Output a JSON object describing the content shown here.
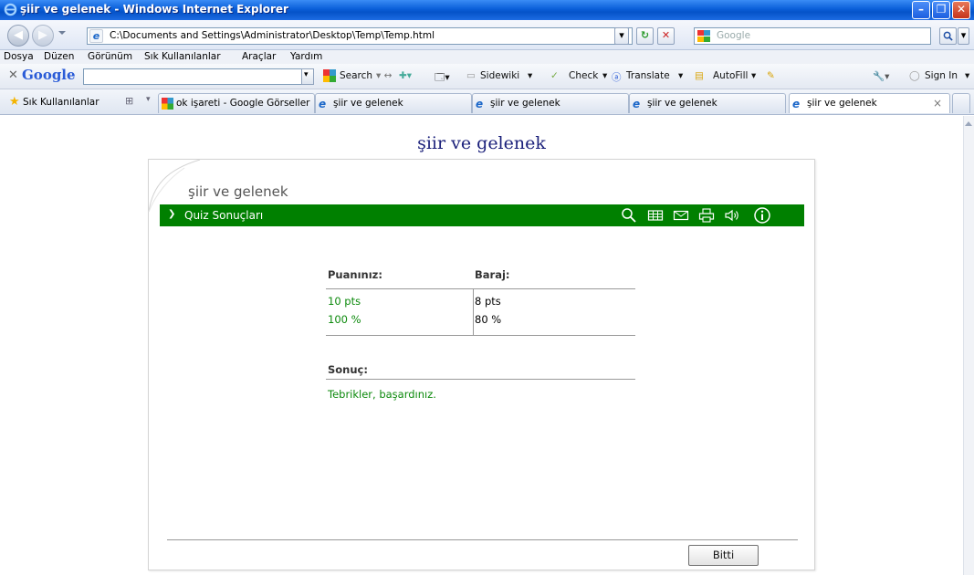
{
  "window": {
    "title": "şiir ve gelenek - Windows Internet Explorer",
    "minimize": "–",
    "maximize": "❐",
    "close": "✕"
  },
  "address_bar": {
    "url": "C:\\Documents and Settings\\Administrator\\Desktop\\Temp\\Temp.html",
    "search_placeholder": "Google"
  },
  "menu": [
    "Dosya",
    "Düzen",
    "Görünüm",
    "Sık Kullanılanlar",
    "Araçlar",
    "Yardım"
  ],
  "google_toolbar": {
    "logo": "Google",
    "search_label": "Search",
    "sidewiki_label": "Sidewiki",
    "check_label": "Check",
    "translate_label": "Translate",
    "autofill_label": "AutoFill",
    "signin_label": "Sign In"
  },
  "tabs_bar": {
    "favorites_label": "Sık Kullanılanlar",
    "tabs": [
      {
        "label": "ok işareti - Google Görseller",
        "active": false
      },
      {
        "label": "şiir ve gelenek",
        "active": false
      },
      {
        "label": "şiir ve gelenek",
        "active": false
      },
      {
        "label": "şiir ve gelenek",
        "active": false
      },
      {
        "label": "şiir ve gelenek",
        "active": true
      }
    ],
    "close_glyph": "×"
  },
  "page": {
    "title": "şiir ve gelenek",
    "quiz_title": "şiir ve gelenek",
    "section_label": "Quiz Sonuçları",
    "score_header": "Puanınız:",
    "threshold_header": "Baraj:",
    "score_points": "10 pts",
    "score_percent": "100 %",
    "threshold_points": "8 pts",
    "threshold_percent": "80 %",
    "result_header": "Sonuç:",
    "result_text": "Tebrikler, başardınız.",
    "done_button": "Bitti"
  },
  "colors": {
    "quiz_bar": "#008000",
    "result_text": "#0d8a0d",
    "page_title": "#1a1f7a"
  },
  "icons": [
    "search-icon",
    "table-icon",
    "mail-icon",
    "print-icon",
    "speaker-icon",
    "info-icon"
  ]
}
